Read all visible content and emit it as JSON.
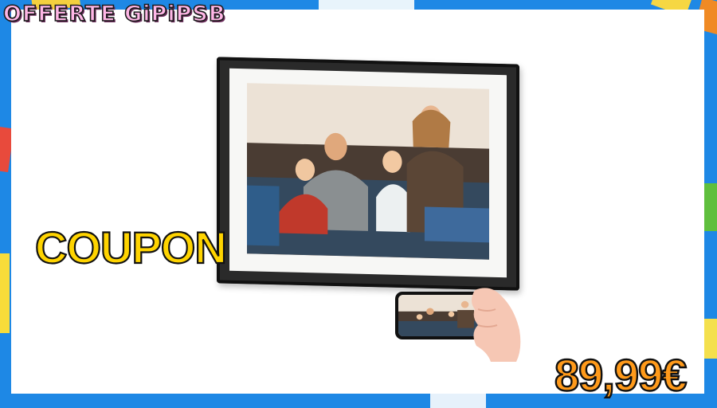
{
  "brand": {
    "title": "OFFERTE GiPiPSB"
  },
  "promo": {
    "coupon_label": "COUPON"
  },
  "offer": {
    "price": "89,99€"
  },
  "colors": {
    "background": "#1e88e5",
    "card": "#ffffff",
    "coupon_fill": "#ffd400",
    "price_fill": "#ff9a1a",
    "brand_fill": "#ffb6e6"
  },
  "images": {
    "product": "digital-photo-frame-with-family-photo",
    "companion": "smartphone-in-hand-showing-same-photo"
  }
}
